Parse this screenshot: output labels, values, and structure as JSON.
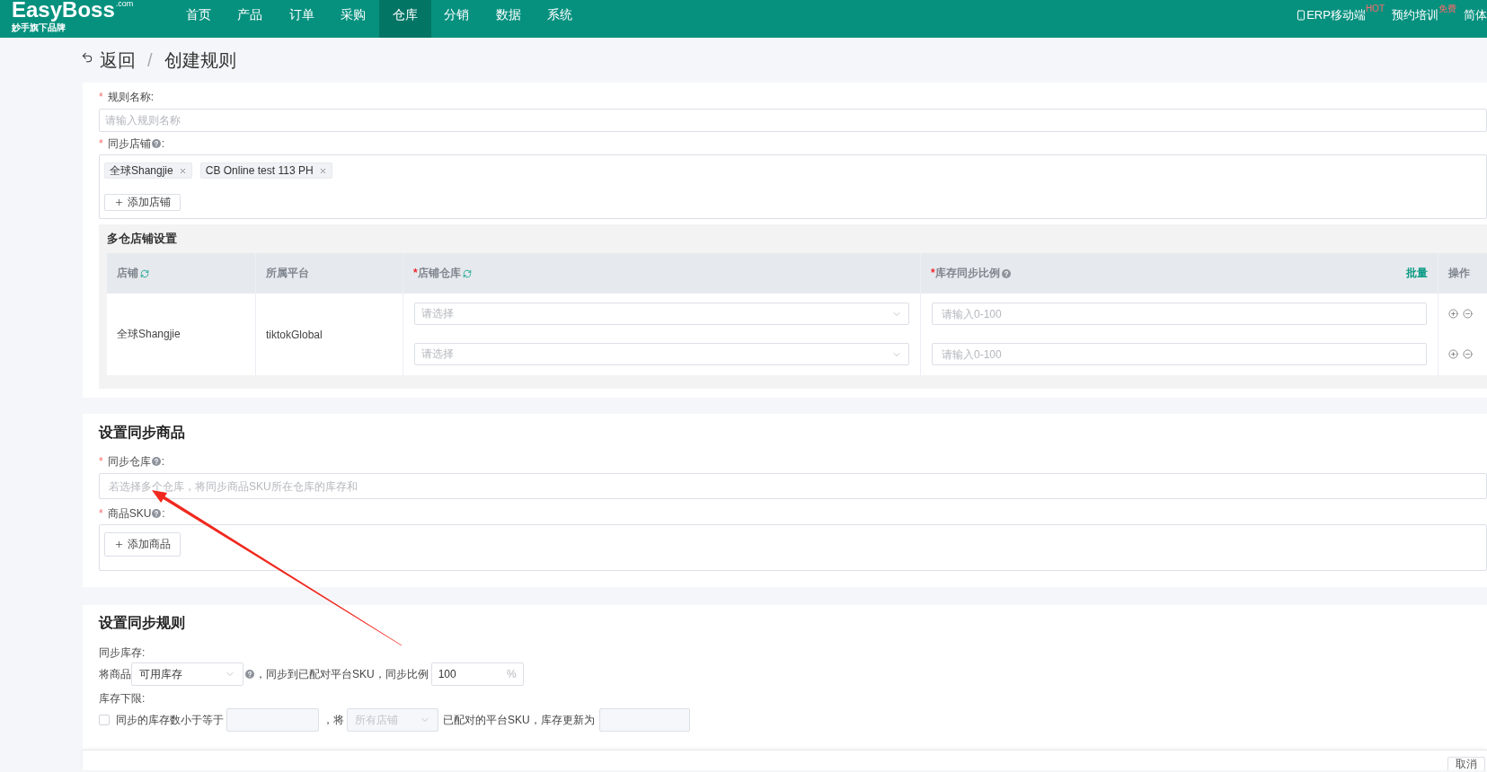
{
  "top_nav": {
    "logo": {
      "name": "EasyBoss",
      "suffix": ".com",
      "tagline": "妙手旗下品牌"
    },
    "items": [
      {
        "label": "首页",
        "selected": false
      },
      {
        "label": "产品",
        "selected": false
      },
      {
        "label": "订单",
        "selected": false
      },
      {
        "label": "采购",
        "selected": false
      },
      {
        "label": "仓库",
        "selected": true
      },
      {
        "label": "分销",
        "selected": false
      },
      {
        "label": "数据",
        "selected": false
      },
      {
        "label": "系统",
        "selected": false
      }
    ],
    "links": [
      {
        "kind": "mobile",
        "label": "ERP移动端",
        "badge": "HOT"
      },
      {
        "kind": "plain",
        "label": "预约培训",
        "badge": "免费"
      },
      {
        "kind": "plain",
        "label": "简体"
      }
    ]
  },
  "breadcrumb": {
    "back": "返回",
    "separator": "/",
    "current": "创建规则"
  },
  "rule_card": {
    "name_field": {
      "mark": "*",
      "label": "规则名称",
      "suffix": ":",
      "placeholder": "请输入规则名称"
    },
    "store_field": {
      "mark": "*",
      "label": "同步店铺",
      "help": true,
      "suffix": ":",
      "tags": [
        "全球Shangjie",
        "CB Online test 113 PH"
      ],
      "add_button": "添加店铺"
    },
    "multi_warehouse": {
      "title": "多仓店铺设置",
      "columns": [
        {
          "label": "店铺",
          "refresh": true
        },
        {
          "label": "所属平台"
        },
        {
          "mark": "*",
          "label": "店铺仓库",
          "refresh": true
        },
        {
          "mark": "*",
          "label": "库存同步比例",
          "help": true,
          "action": "批量"
        },
        {
          "label": "操作"
        }
      ],
      "rows": [
        {
          "store": "全球Shangjie",
          "platform": "tiktokGlobal",
          "entries": [
            {
              "warehouse_placeholder": "请选择",
              "ratio_placeholder": "请输入0-100"
            },
            {
              "warehouse_placeholder": "请选择",
              "ratio_placeholder": "请输入0-100"
            }
          ]
        }
      ]
    }
  },
  "products_card": {
    "title": "设置同步商品",
    "warehouse_field": {
      "mark": "*",
      "label": "同步仓库",
      "help": true,
      "suffix": ":",
      "placeholder": "若选择多个仓库，将同步商品SKU所在仓库的库存和"
    },
    "sku_field": {
      "mark": "*",
      "label": "商品SKU",
      "help": true,
      "suffix": ":",
      "add_button": "添加商品"
    }
  },
  "rules_card": {
    "title": "设置同步规则",
    "sync_stock": {
      "label": "同步库存:",
      "prefix": "将商品",
      "source_value": "可用库存",
      "help": true,
      "middle": "，同步到已配对平台SKU，同步比例",
      "ratio_value": "100",
      "unit": "%"
    },
    "stock_floor": {
      "label": "库存下限:",
      "checked": false,
      "text_1": "同步的库存数小于等于",
      "text_2": "，将",
      "store_placeholder": "所有店铺",
      "text_3": "已配对的平台SKU，库存更新为",
      "disabled": true
    }
  },
  "annotation": {
    "kind": "arrow"
  },
  "footer": {
    "buttons": [
      "取消"
    ]
  }
}
